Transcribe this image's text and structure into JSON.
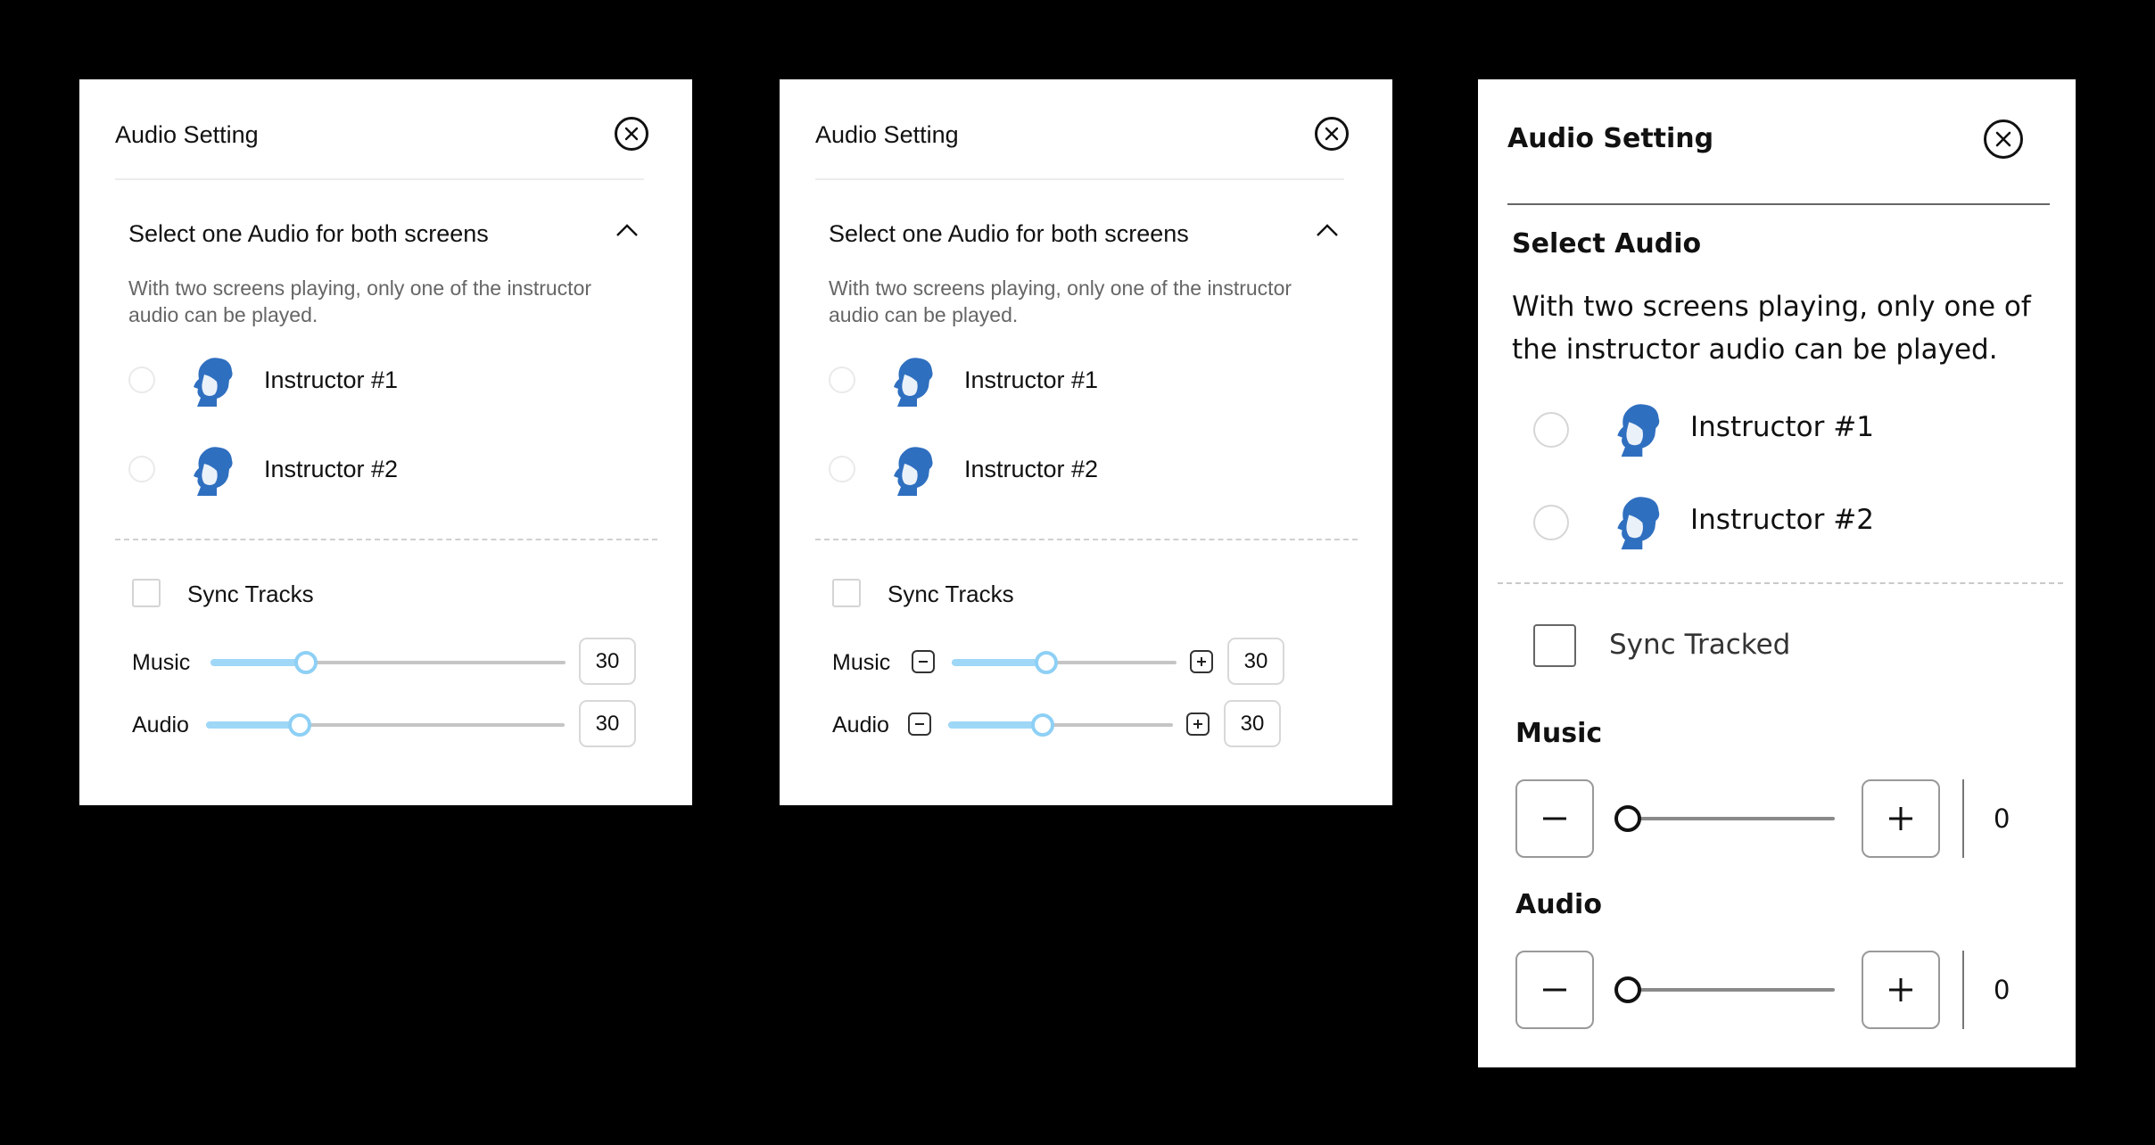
{
  "panels": [
    {
      "title": "Audio Setting",
      "section_title": "Select one Audio for both screens",
      "description": "With two screens playing, only one of the instructor audio can be played.",
      "instructors": [
        {
          "label": "Instructor #1"
        },
        {
          "label": "Instructor #2"
        }
      ],
      "sync_label": "Sync Tracks",
      "sync_checked": false,
      "sliders": [
        {
          "label": "Music",
          "value": "30",
          "level_percent": 27
        },
        {
          "label": "Audio",
          "value": "30",
          "level_percent": 26
        }
      ]
    },
    {
      "title": "Audio Setting",
      "section_title": "Select one Audio for both screens",
      "description": "With two screens playing, only one of the instructor audio can be played.",
      "instructors": [
        {
          "label": "Instructor #1"
        },
        {
          "label": "Instructor #2"
        }
      ],
      "sync_label": "Sync Tracks",
      "sync_checked": false,
      "sliders": [
        {
          "label": "Music",
          "value": "30",
          "level_percent": 42
        },
        {
          "label": "Audio",
          "value": "30",
          "level_percent": 42
        }
      ]
    },
    {
      "title": "Audio Setting",
      "section_title": "Select Audio",
      "description": "With two screens playing, only one of the instructor audio can be played.",
      "instructors": [
        {
          "label": "Instructor #1"
        },
        {
          "label": "Instructor #2"
        }
      ],
      "sync_label": "Sync Tracked",
      "sync_checked": false,
      "sliders": [
        {
          "label": "Music",
          "value": "0",
          "level_percent": 0
        },
        {
          "label": "Audio",
          "value": "0",
          "level_percent": 0
        }
      ]
    }
  ],
  "icons": {
    "close": "close-icon",
    "collapse": "chevron-up-icon",
    "minus": "minus-icon",
    "plus": "plus-icon",
    "avatar": "instructor-avatar"
  },
  "colors": {
    "slider_fill": "#9fd7f7",
    "slider_thumb_border": "#8ed0f5",
    "avatar_blue": "#2f6fc0"
  }
}
